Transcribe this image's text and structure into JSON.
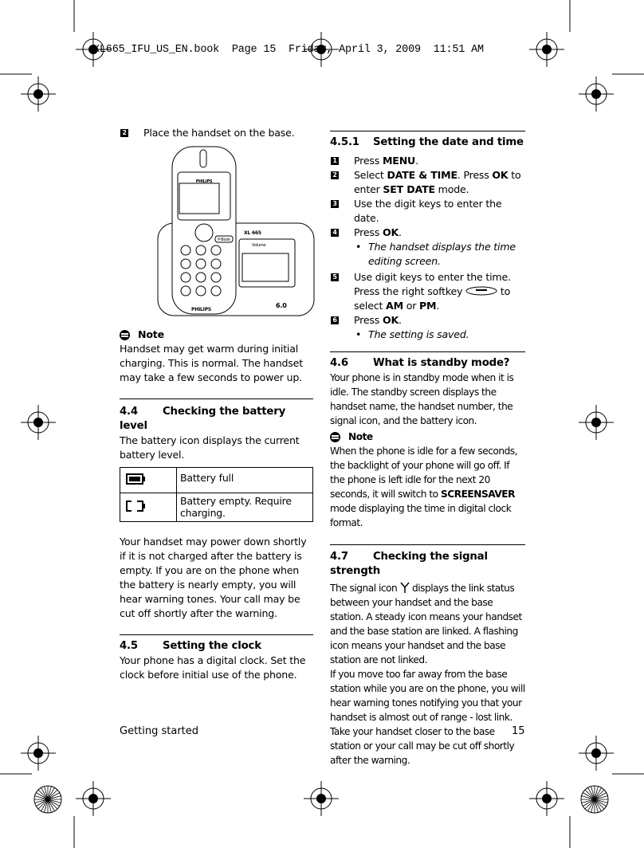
{
  "header_stamp": "XL665_IFU_US_EN.book  Page 15  Friday, April 3, 2009  11:51 AM",
  "left": {
    "step2": {
      "num": "2",
      "text": "Place the handset on the base."
    },
    "image_labels": {
      "brand": "PHILIPS",
      "model": "XL 665",
      "volume": "Volume",
      "book": "P-Book",
      "dect": "6.0"
    },
    "note1": {
      "title": "Note",
      "text": "Handset may get warm during initial charging. This is normal. The handset may take a few seconds to power up."
    },
    "s44": {
      "num": "4.4",
      "title": "Checking the battery level",
      "intro": "The battery icon displays the current battery level.",
      "table": [
        {
          "icon": "battery-full-icon",
          "desc": "Battery full"
        },
        {
          "icon": "battery-empty-icon",
          "desc": "Battery empty. Require charging."
        }
      ],
      "para": "Your handset may power down shortly if it is not charged after the battery is empty. If you are on the phone when the battery is nearly empty, you will hear warning tones. Your call may be cut off shortly after the warning."
    },
    "s45": {
      "num": "4.5",
      "title": "Setting the clock",
      "text": "Your phone has a digital clock. Set the clock before initial use of the phone."
    }
  },
  "right": {
    "s451": {
      "num": "4.5.1",
      "title": "Setting the date and time"
    },
    "steps": [
      "1",
      "2",
      "3",
      "4",
      "5",
      "6"
    ],
    "t": {
      "press": "Press ",
      "menu": "MENU",
      "dot": ".",
      "select": "Select ",
      "dt": "DATE & TIME",
      "press2": ". Press ",
      "ok": "OK",
      "to": " to",
      "enter": "enter ",
      "setdate": "SET DATE",
      "mode": " mode.",
      "s3": "Use the digit keys to enter the date.",
      "b4": "The handset displays the time editing screen.",
      "s5a": "Use digit keys to enter the time.",
      "s5b": "Press the right softkey",
      "s5c": " to",
      "s5d": "select ",
      "am": "AM",
      "or": " or ",
      "pm": "PM",
      "b6": "The setting is saved."
    },
    "s46": {
      "num": "4.6",
      "title": "What is standby mode?",
      "text": "Your phone is in standby mode when it is idle. The standby screen displays the handset name, the handset number, the signal icon, and the battery icon.",
      "note_title": "Note",
      "note_a": "When the phone is idle for a few seconds, the backlight of your phone will go off. If the phone is left idle for the next 20 seconds, it will switch to ",
      "note_b": "SCREENSAVER",
      "note_c": " mode displaying the time in digital clock format."
    },
    "s47": {
      "num": "4.7",
      "title": "Checking the signal strength",
      "a": "The signal icon ",
      "b": " displays the link status between your handset and the base station. A steady icon means your handset and the base station are linked. A flashing icon means your handset and the base station are not linked.",
      "c": "If you move too far away from the base station while you are on the phone, you will hear warning tones notifying you that your handset is almost out of range - lost link. Take your handset closer to the base station or your call may be cut off shortly after the warning."
    }
  },
  "footer": {
    "section": "Getting started",
    "page": "15"
  }
}
